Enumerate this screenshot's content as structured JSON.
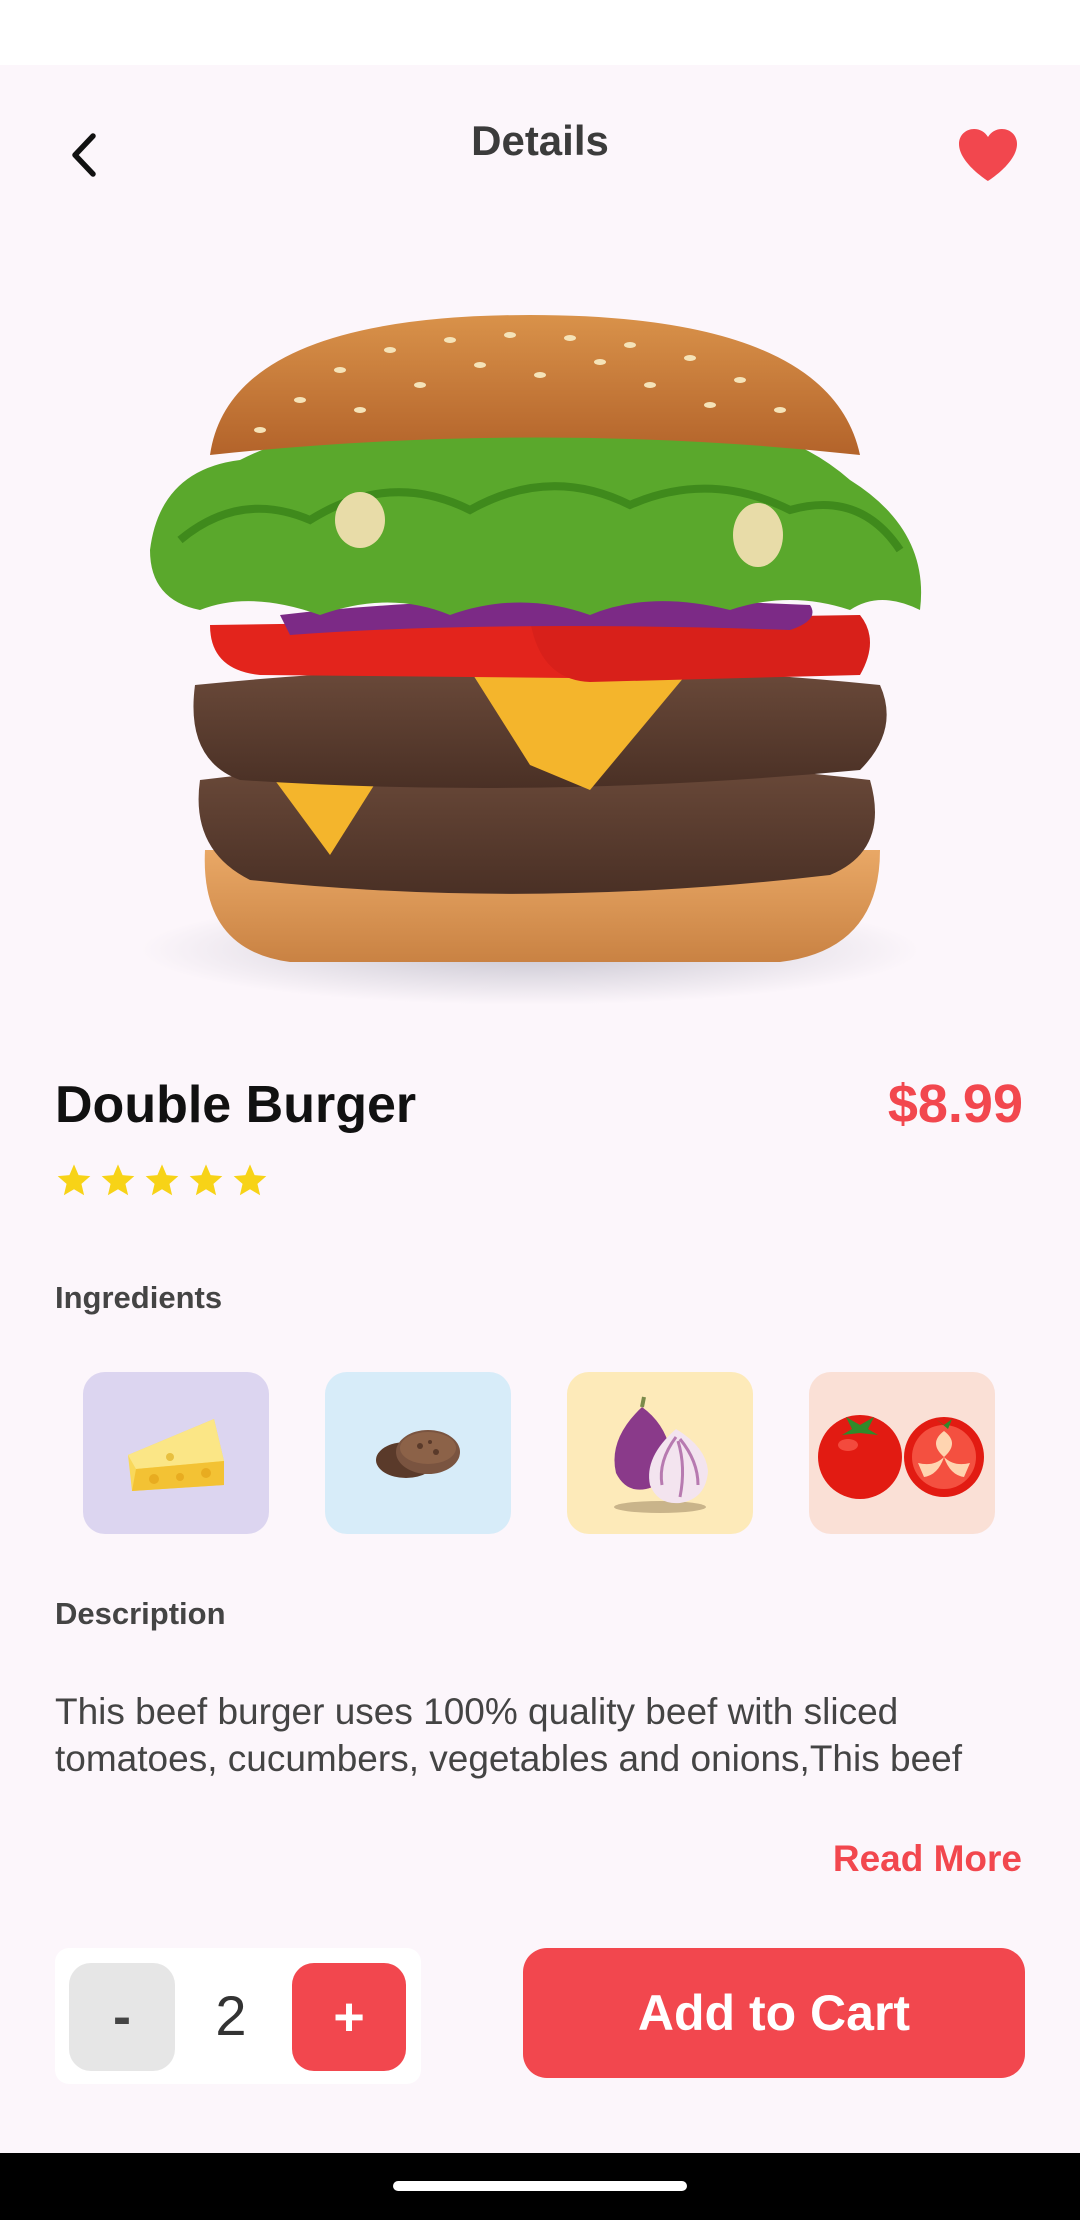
{
  "header": {
    "title": "Details",
    "back_icon": "chevron-left-icon",
    "favorite_icon": "heart-icon",
    "favorite_color": "#f2474e"
  },
  "product": {
    "name": "Double Burger",
    "price": "$8.99",
    "rating": 5,
    "rating_max": 5,
    "image": "double-burger-image"
  },
  "ingredients": {
    "label": "Ingredients",
    "items": [
      {
        "icon": "cheese-icon",
        "bg": "#dcd5f0"
      },
      {
        "icon": "beef-patty-icon",
        "bg": "#d7ecf9"
      },
      {
        "icon": "onion-icon",
        "bg": "#fdeab9"
      },
      {
        "icon": "tomato-icon",
        "bg": "#fae0d6"
      }
    ]
  },
  "description": {
    "label": "Description",
    "text": "This beef burger uses 100% quality beef with sliced tomatoes, cucumbers, vegetables and onions,This beef",
    "read_more": "Read More"
  },
  "cart": {
    "minus_label": "-",
    "quantity": "2",
    "plus_label": "+",
    "add_label": "Add to Cart"
  },
  "colors": {
    "accent": "#f2474e",
    "background": "#fcf6fb"
  }
}
